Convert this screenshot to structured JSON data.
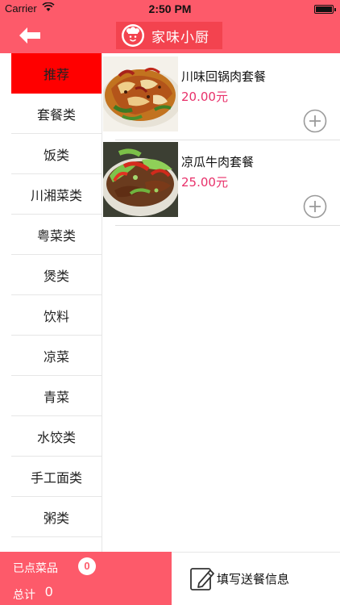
{
  "status_bar": {
    "carrier": "Carrier",
    "time": "2:50 PM"
  },
  "nav": {
    "title": "家味小厨",
    "back_icon": "back-arrow-icon",
    "logo_icon": "chef-logo-icon"
  },
  "categories": [
    "推荐",
    "套餐类",
    "饭类",
    "川湘菜类",
    "粤菜类",
    "煲类",
    "饮料",
    "凉菜",
    "青菜",
    "水饺类",
    "手工面类",
    "粥类"
  ],
  "active_category": "推荐",
  "dishes": [
    {
      "name": "川味回锅肉套餐",
      "price": "20.00元"
    },
    {
      "name": "凉瓜牛肉套餐",
      "price": "25.00元"
    }
  ],
  "cart": {
    "ordered_label": "已点菜品",
    "ordered_count": "0",
    "total_label": "总计",
    "total_value": "0"
  },
  "fill_info": {
    "label": "填写送餐信息",
    "icon": "edit-icon"
  },
  "colors": {
    "accent": "#fd5a6a",
    "active_category": "#ff0000",
    "price": "#e8306a"
  }
}
